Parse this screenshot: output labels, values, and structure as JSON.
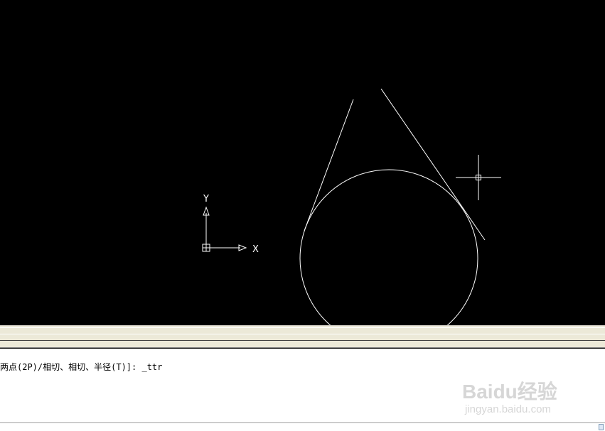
{
  "drawing": {
    "background": "#000000",
    "stroke_color": "#ffffff",
    "ucs_icon": {
      "x_label": "X",
      "y_label": "Y"
    }
  },
  "command_window": {
    "line": "两点(2P)/相切、相切、半径(T)]: _ttr"
  },
  "watermark": {
    "logo_text": "Baidu经验",
    "url_text": "jingyan.baidu.com"
  }
}
